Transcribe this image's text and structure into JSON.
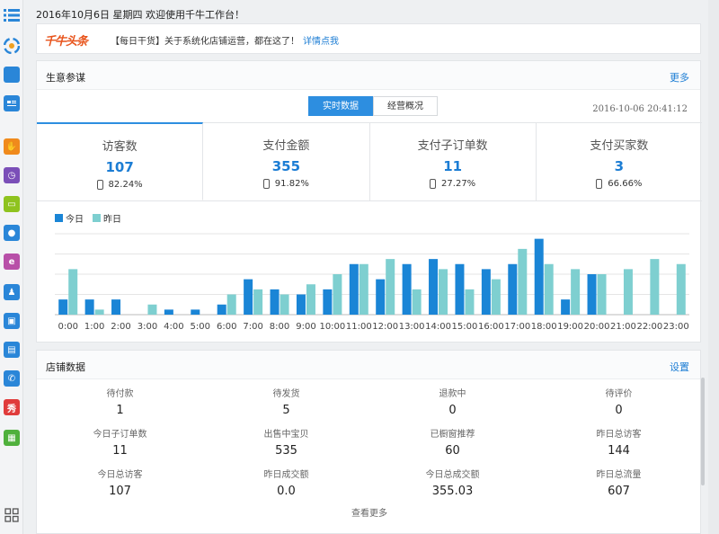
{
  "header": {
    "date_text": "2016年10月6日 星期四 欢迎使用千牛工作台！"
  },
  "news": {
    "logo": "千牛头条",
    "text": "【每日干货】关于系统化店铺运营，都在这了！",
    "link": "详情点我"
  },
  "business": {
    "title": "生意参谋",
    "more": "更多",
    "tabs": [
      "实时数据",
      "经营概况"
    ],
    "timestamp": "2016-10-06 20:41:12",
    "stats": [
      {
        "label": "访客数",
        "value": "107",
        "pct": "82.24%"
      },
      {
        "label": "支付金额",
        "value": "355",
        "pct": "91.82%"
      },
      {
        "label": "支付子订单数",
        "value": "11",
        "pct": "27.27%"
      },
      {
        "label": "支付买家数",
        "value": "3",
        "pct": "66.66%"
      }
    ]
  },
  "chart_data": {
    "type": "bar",
    "categories": [
      "0:00",
      "1:00",
      "2:00",
      "3:00",
      "4:00",
      "5:00",
      "6:00",
      "7:00",
      "8:00",
      "9:00",
      "10:00",
      "11:00",
      "12:00",
      "13:00",
      "14:00",
      "15:00",
      "16:00",
      "17:00",
      "18:00",
      "19:00",
      "20:00",
      "21:00",
      "22:00",
      "23:00"
    ],
    "series": [
      {
        "name": "今日",
        "color": "#1a85d6",
        "values": [
          3,
          3,
          3,
          0,
          1,
          1,
          2,
          7,
          5,
          4,
          5,
          10,
          7,
          10,
          11,
          10,
          9,
          10,
          15,
          3,
          8,
          0,
          0,
          0
        ]
      },
      {
        "name": "昨日",
        "color": "#7ecfd0",
        "values": [
          9,
          1,
          0,
          2,
          0,
          0,
          4,
          5,
          4,
          6,
          8,
          10,
          11,
          5,
          9,
          5,
          7,
          13,
          10,
          9,
          8,
          9,
          11,
          10
        ]
      }
    ],
    "ylim": [
      0,
      16
    ]
  },
  "store": {
    "title": "店铺数据",
    "settings": "设置",
    "cells": [
      {
        "label": "待付款",
        "value": "1"
      },
      {
        "label": "待发货",
        "value": "5"
      },
      {
        "label": "退款中",
        "value": "0"
      },
      {
        "label": "待评价",
        "value": "0"
      },
      {
        "label": "今日子订单数",
        "value": "11"
      },
      {
        "label": "出售中宝贝",
        "value": "535"
      },
      {
        "label": "已橱窗推荐",
        "value": "60"
      },
      {
        "label": "昨日总访客",
        "value": "144"
      },
      {
        "label": "今日总访客",
        "value": "107"
      },
      {
        "label": "昨日成交额",
        "value": "0.0"
      },
      {
        "label": "今日总成交额",
        "value": "355.03"
      },
      {
        "label": "昨日总流量",
        "value": "607"
      }
    ],
    "more": "查看更多"
  },
  "sidebar": {
    "icons": [
      "menu-icon",
      "qianniu-logo-icon",
      "shopping-bag-icon",
      "id-card-icon",
      "hand-icon",
      "clock-icon",
      "store-icon",
      "chat-icon",
      "e-icon",
      "user-icon",
      "bag-icon",
      "report-icon",
      "phone-icon",
      "show-icon",
      "calendar-icon",
      "apps-grid-icon"
    ],
    "show_text": "秀"
  }
}
